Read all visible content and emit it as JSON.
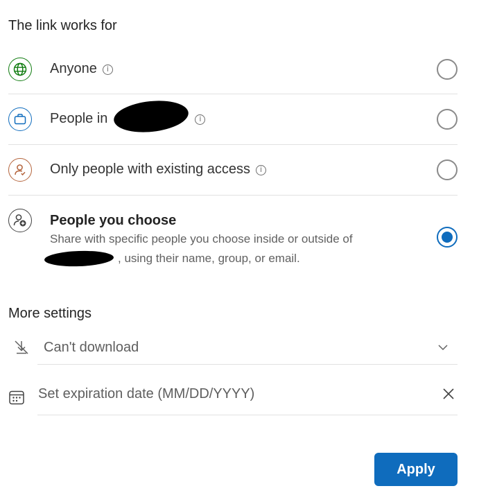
{
  "link_works_for": {
    "heading": "The link works for",
    "options": [
      {
        "label": "Anyone",
        "icon": "globe-icon",
        "selected": false
      },
      {
        "label": "People in",
        "icon": "briefcase-icon",
        "selected": false
      },
      {
        "label": "Only people with existing access",
        "icon": "person-check-icon",
        "selected": false
      },
      {
        "label": "People you choose",
        "icon": "person-add-icon",
        "selected": true,
        "description_line1": "Share with specific people you choose inside or outside of",
        "description_line2": ", using their name, group, or email."
      }
    ]
  },
  "more_settings": {
    "heading": "More settings",
    "download_setting": "Can't download",
    "expiration_placeholder": "Set expiration date (MM/DD/YYYY)"
  },
  "apply_label": "Apply",
  "colors": {
    "accent": "#0f6cbd",
    "globe_green": "#107c10",
    "briefcase_blue": "#0f6cbd",
    "person_orange": "#b4643c"
  }
}
